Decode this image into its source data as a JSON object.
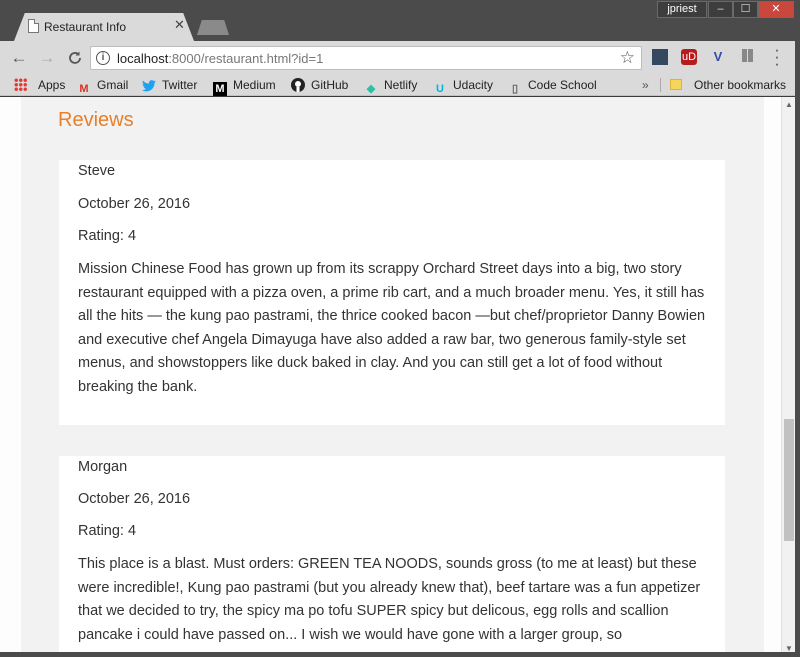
{
  "window": {
    "tab_title": "Restaurant Info",
    "tab_close": "✕",
    "user": "jpriest",
    "min_label": "–",
    "max_label": "☐",
    "close_label": "✕"
  },
  "toolbar": {
    "back": "←",
    "forward": "→",
    "reload": "C",
    "url_host": "localhost",
    "url_rest": ":8000/restaurant.html?id=1",
    "info_icon": "i",
    "star": "☆",
    "ext2_label": "uD",
    "ext3_label": "V",
    "menu": "⋮"
  },
  "bookmarks": {
    "items": [
      {
        "label": "Apps",
        "icon": "apps-grid-icon"
      },
      {
        "label": "Gmail",
        "icon": "gmail-icon",
        "glyph": "M",
        "color": "#d93025"
      },
      {
        "label": "Twitter",
        "icon": "twitter-icon",
        "glyph": "🐦",
        "color": "#1da1f2"
      },
      {
        "label": "Medium",
        "icon": "medium-icon",
        "glyph": "M",
        "color": "#000000"
      },
      {
        "label": "GitHub",
        "icon": "github-icon",
        "glyph": "●",
        "color": "#222222"
      },
      {
        "label": "Netlify",
        "icon": "netlify-icon",
        "glyph": "◆",
        "color": "#2ebfa5"
      },
      {
        "label": "Udacity",
        "icon": "udacity-icon",
        "glyph": "U",
        "color": "#02b3e4"
      },
      {
        "label": "Code School",
        "icon": "page-icon",
        "glyph": "▯",
        "color": "#666666"
      }
    ],
    "overflow": "»",
    "other": "Other bookmarks"
  },
  "page": {
    "section_title": "Reviews",
    "reviews": [
      {
        "name": "Steve",
        "date": "October 26, 2016",
        "rating": "Rating: 4",
        "comments": "Mission Chinese Food has grown up from its scrappy Orchard Street days into a big, two story restaurant equipped with a pizza oven, a prime rib cart, and a much broader menu. Yes, it still has all the hits — the kung pao pastrami, the thrice cooked bacon —but chef/proprietor Danny Bowien and executive chef Angela Dimayuga have also added a raw bar, two generous family-style set menus, and showstoppers like duck baked in clay. And you can still get a lot of food without breaking the bank."
      },
      {
        "name": "Morgan",
        "date": "October 26, 2016",
        "rating": "Rating: 4",
        "comments": "This place is a blast. Must orders: GREEN TEA NOODS, sounds gross (to me at least) but these were incredible!, Kung pao pastrami (but you already knew that), beef tartare was a fun appetizer that we decided to try, the spicy ma po tofu SUPER spicy but delicous, egg rolls and scallion pancake i could have passed on... I wish we would have gone with a larger group, so"
      }
    ]
  },
  "colors": {
    "accent": "#e87f2a",
    "page_bg": "#f2f2f2",
    "card_bg": "#ffffff"
  }
}
